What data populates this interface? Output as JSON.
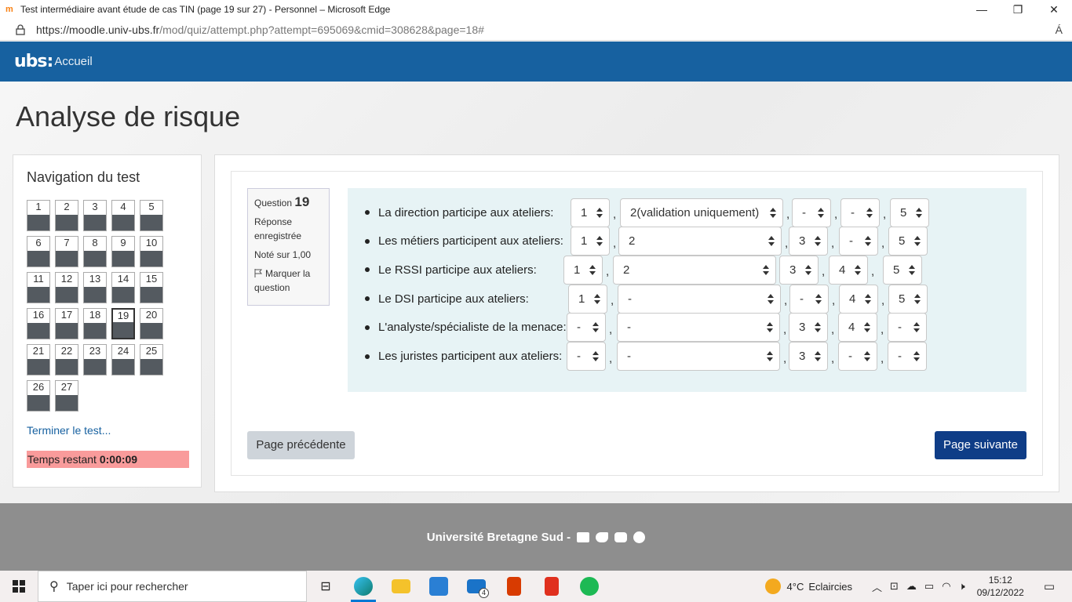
{
  "window": {
    "favicon": "m",
    "title": "Test intermédiaire avant étude de cas TIN (page 19 sur 27) - Personnel – Microsoft Edge",
    "minimize": "—",
    "maximize": "❐",
    "close": "✕"
  },
  "address": {
    "url_host": "https://moodle.univ-ubs.fr",
    "url_path": "/mod/quiz/attempt.php?attempt=695069&cmid=308628&page=18#",
    "read_aloud": "Á"
  },
  "navbar": {
    "logo": "ubs:",
    "home": "Accueil"
  },
  "page": {
    "title": "Analyse de risque"
  },
  "quiz_nav": {
    "heading": "Navigation du test",
    "questions": [
      "1",
      "2",
      "3",
      "4",
      "5",
      "6",
      "7",
      "8",
      "9",
      "10",
      "11",
      "12",
      "13",
      "14",
      "15",
      "16",
      "17",
      "18",
      "19",
      "20",
      "21",
      "22",
      "23",
      "24",
      "25",
      "26",
      "27"
    ],
    "current": "19",
    "finish_link": "Terminer le test...",
    "timer_label": "Temps restant ",
    "timer_value": "0:00:09"
  },
  "question_info": {
    "label": "Question ",
    "number": "19",
    "state": "Réponse enregistrée",
    "grade": "Noté sur 1,00",
    "flag": "Marquer la question",
    "flag_icon": "flag-icon"
  },
  "rows": [
    {
      "label": "La direction participe aux ateliers:",
      "values": [
        "1",
        "2(validation uniquement)",
        "-",
        "-",
        "5"
      ]
    },
    {
      "label": "Les métiers participent aux ateliers:",
      "values": [
        "1",
        "2",
        "3",
        "-",
        "5"
      ]
    },
    {
      "label": "Le RSSI participe aux ateliers:",
      "values": [
        "1",
        "2",
        "3",
        "4",
        "5"
      ]
    },
    {
      "label": "Le DSI participe aux ateliers:",
      "values": [
        "1",
        "-",
        "-",
        "4",
        "5"
      ]
    },
    {
      "label": "L'analyste/spécialiste de la menace:",
      "values": [
        "-",
        "-",
        "3",
        "4",
        "-"
      ]
    },
    {
      "label": "Les juristes participent aux ateliers:",
      "values": [
        "-",
        "-",
        "3",
        "-",
        "-"
      ]
    }
  ],
  "buttons": {
    "prev": "Page précédente",
    "next": "Page suivante"
  },
  "footer": {
    "text": "Université Bretagne Sud -",
    "icons": [
      "envelope-icon",
      "twitter-icon",
      "youtube-icon",
      "wordpress-icon"
    ]
  },
  "taskbar": {
    "search_placeholder": "Taper ici pour rechercher",
    "mail_badge": "4",
    "weather_temp": "4°C",
    "weather_text": "Eclaircies",
    "time": "15:12",
    "date": "09/12/2022",
    "accent": "#0078d4"
  },
  "colors": {
    "navbar": "#1761a0",
    "next_button": "#0f3d87",
    "timer_bg": "#f99b9b",
    "formulation_bg": "#e7f3f5"
  }
}
